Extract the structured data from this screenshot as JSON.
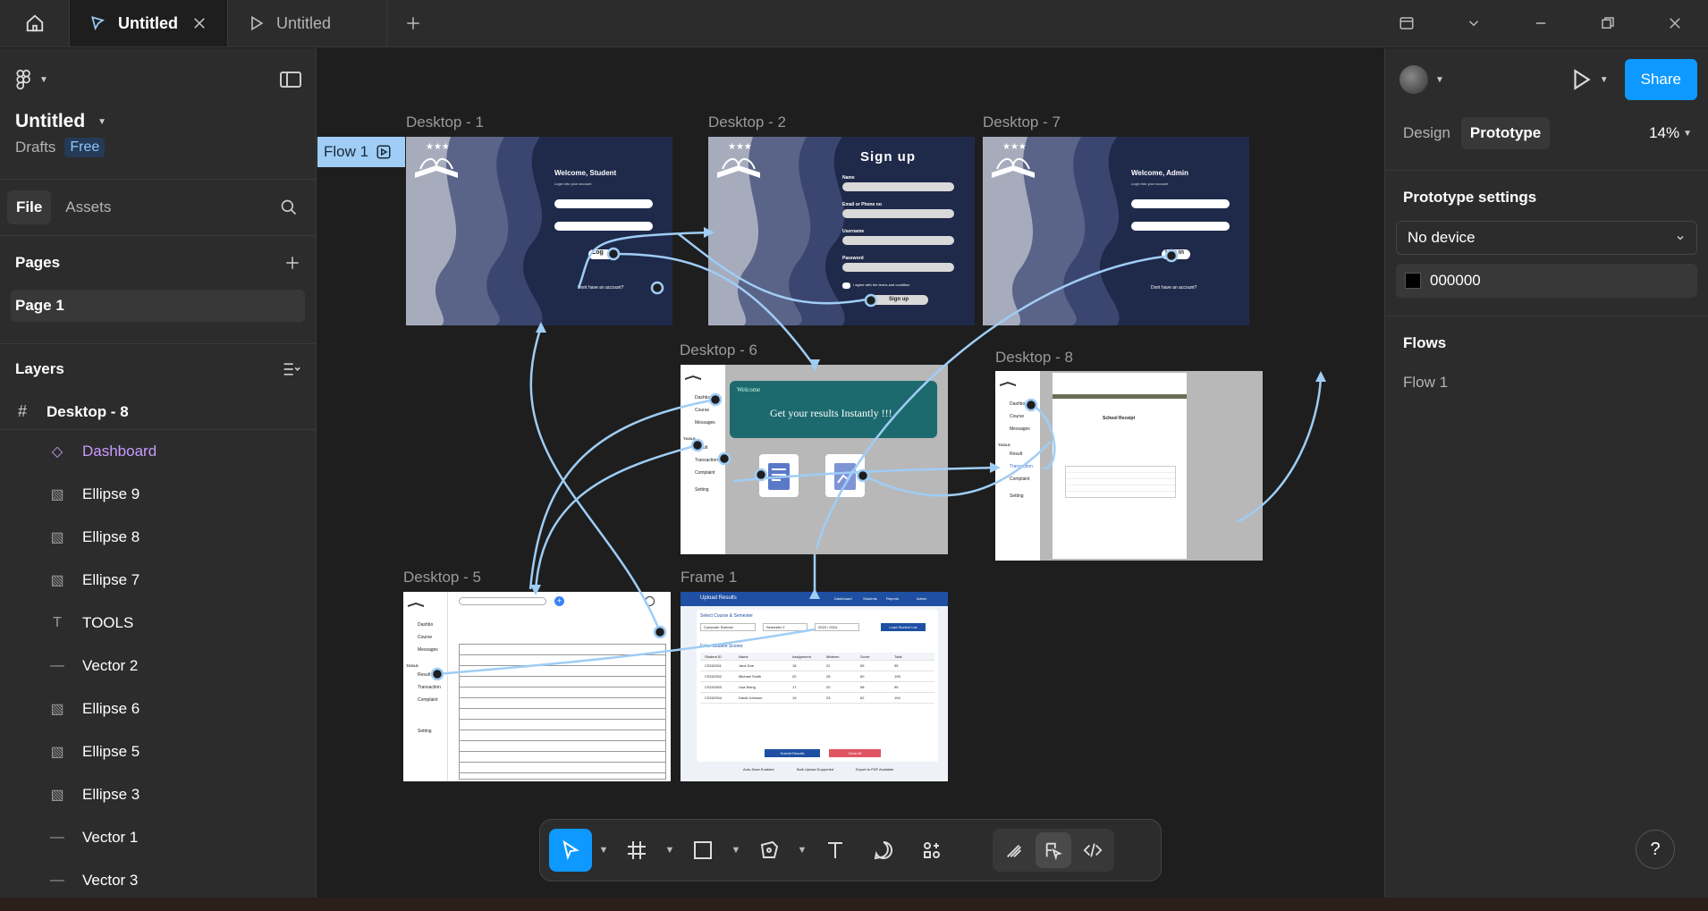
{
  "tabs": {
    "active_label": "Untitled",
    "inactive_label": "Untitled"
  },
  "left": {
    "file_name": "Untitled",
    "drafts_label": "Drafts",
    "plan_badge": "Free",
    "tab_file": "File",
    "tab_assets": "Assets",
    "pages_heading": "Pages",
    "pages": [
      "Page 1"
    ],
    "layers_heading": "Layers",
    "layer_root": "Desktop - 8",
    "layers": [
      {
        "label": "Dashboard",
        "icon": "component-icon"
      },
      {
        "label": "Ellipse 9",
        "icon": "image-icon"
      },
      {
        "label": "Ellipse 8",
        "icon": "image-icon"
      },
      {
        "label": "Ellipse 7",
        "icon": "image-icon"
      },
      {
        "label": "TOOLS",
        "icon": "text-icon"
      },
      {
        "label": "Vector 2",
        "icon": "line-icon"
      },
      {
        "label": "Ellipse 6",
        "icon": "image-icon"
      },
      {
        "label": "Ellipse 5",
        "icon": "image-icon"
      },
      {
        "label": "Ellipse 3",
        "icon": "image-icon"
      },
      {
        "label": "Vector 1",
        "icon": "line-icon"
      },
      {
        "label": "Vector 3",
        "icon": "line-icon"
      }
    ]
  },
  "canvas": {
    "flow_label": "Flow 1",
    "frames": {
      "d1": "Desktop - 1",
      "d2": "Desktop - 2",
      "d7": "Desktop - 7",
      "d6": "Desktop - 6",
      "d8": "Desktop - 8",
      "d5": "Desktop - 5",
      "f1": "Frame 1"
    },
    "d1_heading": "Welcome, Student",
    "d1_sub": "Login into your account",
    "d1_btn": "Log",
    "d1_link": "Dont have an account?",
    "d2_heading": "Sign up",
    "d2_fields": [
      "Name",
      "Email or Phone no",
      "Username",
      "Password"
    ],
    "d2_terms": "I agree with the terms and condition",
    "d2_btn": "Sign up",
    "d7_heading": "Welcome, Admin",
    "d7_sub": "Login into your account",
    "d7_btn": "Log in",
    "d7_link": "Dont have an account?",
    "d6_welcome": "Welcome",
    "d6_banner": "Get your results Instantly !!!",
    "sidebar_items": [
      "Dashbo",
      "Course",
      "Messages"
    ],
    "tools_label": "TOOLS",
    "sidebar_tools": [
      "Result",
      "Transaction",
      "Complaint",
      "Setting"
    ],
    "d8_receipt_title": "School Receipt",
    "f1_header": "Upload Results",
    "f1_nav": [
      "Dashboard",
      "Students",
      "Reports",
      "Admin"
    ],
    "f1_section1": "Select Course & Semester",
    "f1_selects": [
      "Computer Science",
      "Semester 2",
      "2023 / 2024"
    ],
    "f1_load_btn": "Load Student List",
    "f1_section2": "Enter Student Scores",
    "f1_cols": [
      "Student ID",
      "Name",
      "Assignment",
      "Midterm",
      "Score",
      "Total"
    ],
    "f1_rows": [
      [
        "CS202301",
        "Jane Doe",
        "18",
        "22",
        "55",
        "95"
      ],
      [
        "CS202302",
        "Michael Smith",
        "20",
        "25",
        "60",
        "105"
      ],
      [
        "CS202303",
        "Lisa Wong",
        "17",
        "20",
        "58",
        "95"
      ],
      [
        "CS202304",
        "David Johnson",
        "19",
        "23",
        "62",
        "104"
      ]
    ],
    "f1_submit": "Submit Results",
    "f1_clear": "Clear All",
    "f1_footer": [
      "Auto-Save Enabled",
      "Bulk Upload Supported",
      "Export to PDF Available"
    ]
  },
  "right": {
    "share_label": "Share",
    "tab_design": "Design",
    "tab_prototype": "Prototype",
    "zoom": "14%",
    "settings_heading": "Prototype settings",
    "device_value": "No device",
    "bg_color_hex": "000000",
    "flows_heading": "Flows",
    "flows": [
      "Flow 1"
    ]
  },
  "toolbar": {
    "tools": [
      "move-tool",
      "frame-tool",
      "shape-tool",
      "pen-tool",
      "text-tool",
      "comment-tool",
      "actions-tool",
      "draw-mode",
      "design-mode",
      "dev-mode"
    ]
  },
  "colors": {
    "accent": "#0d99ff",
    "flow_line": "#9fcdf5",
    "login_bg": "#1f2a4a"
  }
}
